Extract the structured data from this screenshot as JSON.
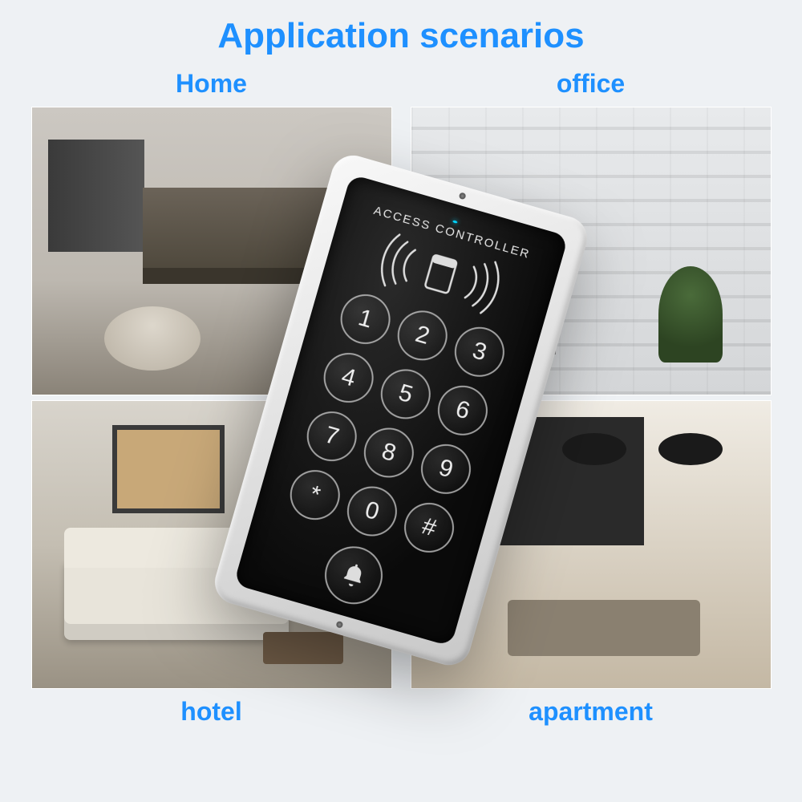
{
  "title": "Application scenarios",
  "scenes": {
    "home": "Home",
    "office": "office",
    "hotel": "hotel",
    "apartment": "apartment"
  },
  "device": {
    "label": "ACCESS CONTROLLER",
    "keys": [
      "1",
      "2",
      "3",
      "4",
      "5",
      "6",
      "7",
      "8",
      "9",
      "*",
      "0",
      "#"
    ],
    "bell_icon": "bell-icon",
    "rfid_icon": "rfid-card-icon"
  },
  "colors": {
    "accent": "#1e90ff"
  }
}
